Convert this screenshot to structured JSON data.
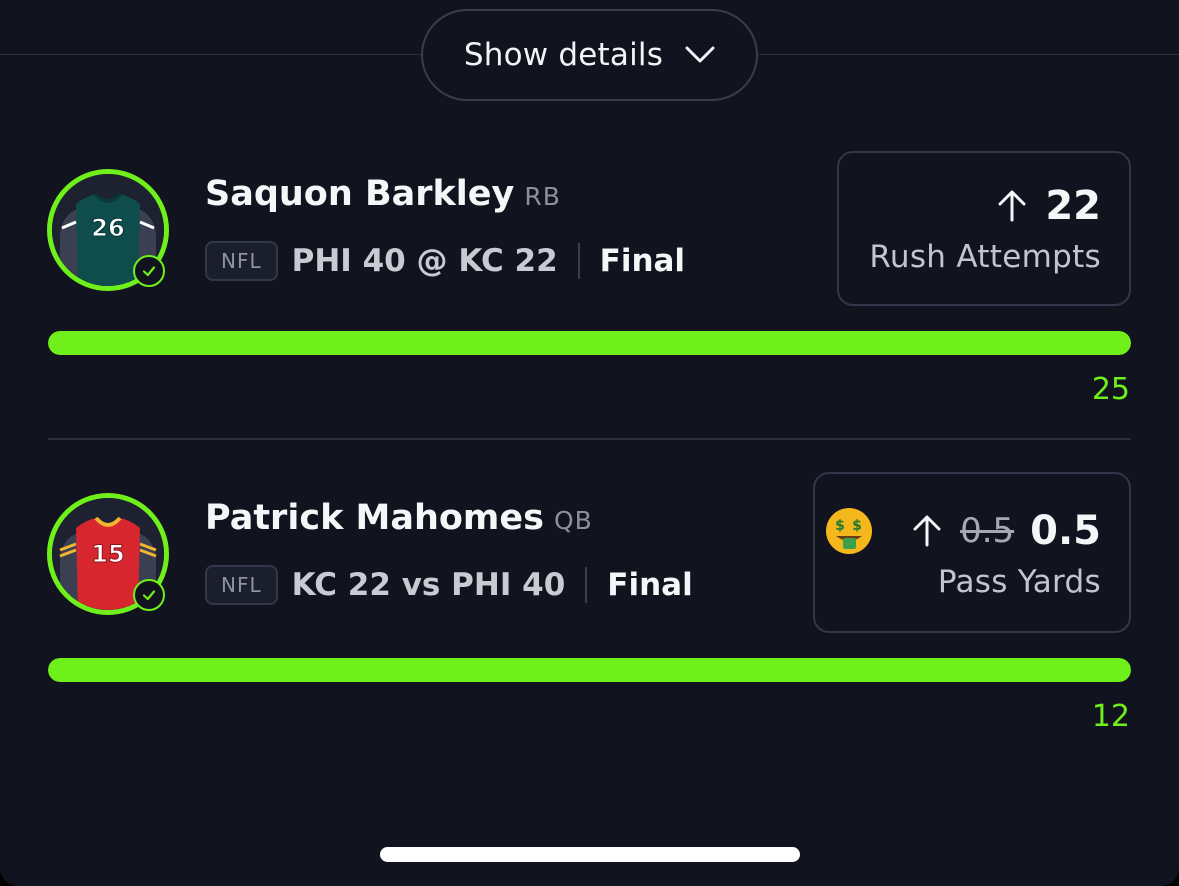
{
  "header": {
    "details_label": "Show details"
  },
  "picks": [
    {
      "player_name": "Saquon Barkley",
      "position": "RB",
      "jersey_number": "26",
      "jersey_color": "#0f4d4d",
      "league": "NFL",
      "matchup": "PHI 40 @ KC 22",
      "status": "Final",
      "direction_icon": "arrow-up-icon",
      "line": "22",
      "stat": "Rush Attempts",
      "result": "25",
      "progress_percent": 100
    },
    {
      "player_name": "Patrick Mahomes",
      "position": "QB",
      "jersey_number": "15",
      "jersey_color": "#d8262f",
      "league": "NFL",
      "matchup": "KC 22 vs PHI 40",
      "status": "Final",
      "promo_icon": "money-mouth-face-icon",
      "direction_icon": "arrow-up-icon",
      "original_line": "0.5",
      "line": "0.5",
      "stat": "Pass Yards",
      "result": "12",
      "progress_percent": 100
    }
  ],
  "colors": {
    "accent": "#6ff01b",
    "background": "#11131e"
  }
}
